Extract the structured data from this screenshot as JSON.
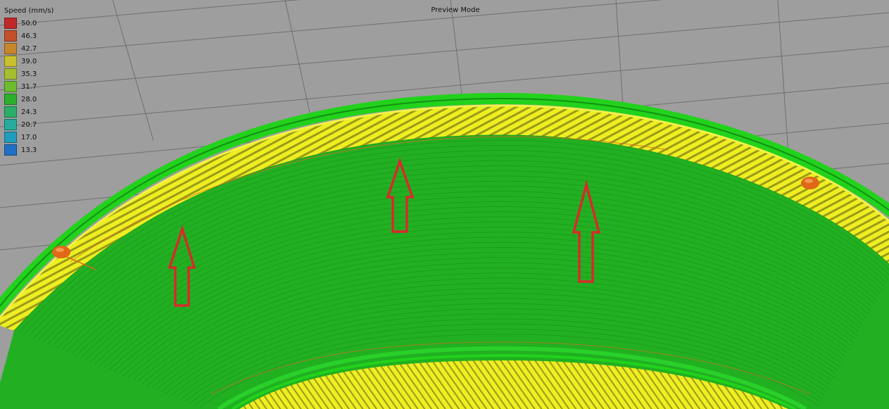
{
  "window": {
    "mode_label": "Preview Mode"
  },
  "legend": {
    "title": "Speed (mm/s)",
    "items": [
      {
        "value": "50.0",
        "color": "#c0282a"
      },
      {
        "value": "46.3",
        "color": "#c4502a"
      },
      {
        "value": "42.7",
        "color": "#c8862c"
      },
      {
        "value": "39.0",
        "color": "#c8c02e"
      },
      {
        "value": "35.3",
        "color": "#a4c02e"
      },
      {
        "value": "31.7",
        "color": "#6cbc2e"
      },
      {
        "value": "28.0",
        "color": "#2cb02e"
      },
      {
        "value": "24.3",
        "color": "#2aae6a"
      },
      {
        "value": "20.7",
        "color": "#26ac9c"
      },
      {
        "value": "17.0",
        "color": "#229cbe"
      },
      {
        "value": "13.3",
        "color": "#2070c4"
      }
    ]
  },
  "scene": {
    "background_color": "#9e9e9e",
    "grid_line_color": "#6f6f6f",
    "perimeter_color": "#22d21c",
    "infill_color": "#eeee22",
    "wall_color": "#20b020",
    "seam_color": "#e06818",
    "annotation_color": "#d82a2a"
  }
}
